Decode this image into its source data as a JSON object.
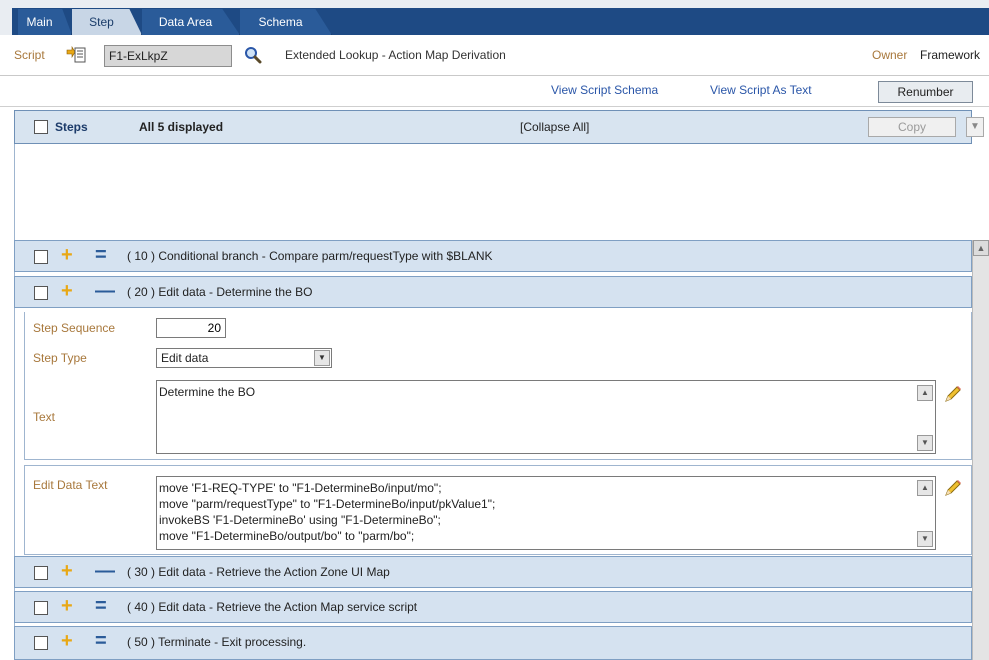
{
  "tabs": [
    {
      "label": "Main",
      "active": false
    },
    {
      "label": "Step",
      "active": true
    },
    {
      "label": "Data Area",
      "active": false
    },
    {
      "label": "Schema",
      "active": false
    }
  ],
  "script": {
    "label": "Script",
    "value": "F1-ExLkpZ",
    "description": "Extended Lookup - Action Map Derivation",
    "owner_label": "Owner",
    "owner_value": "Framework"
  },
  "links": {
    "view_schema": "View Script Schema",
    "view_text": "View Script As Text",
    "renumber": "Renumber"
  },
  "steps_header": {
    "title": "Steps",
    "count": "All 5 displayed",
    "collapse": "[Collapse All]",
    "copy": "Copy"
  },
  "steps": [
    {
      "seq": "10",
      "text": "( 10 ) Conditional branch - Compare parm/requestType with $BLANK"
    },
    {
      "seq": "20",
      "text": "( 20 ) Edit data - Determine the BO"
    },
    {
      "seq": "30",
      "text": "( 30 ) Edit data - Retrieve the Action Zone UI Map"
    },
    {
      "seq": "40",
      "text": "( 40 ) Edit data - Retrieve the Action Map service script"
    },
    {
      "seq": "50",
      "text": "( 50 ) Terminate - Exit processing."
    }
  ],
  "detail": {
    "seq_label": "Step Sequence",
    "seq_value": "20",
    "type_label": "Step Type",
    "type_value": "Edit data",
    "text_label": "Text",
    "text_value": "Determine the BO",
    "edit_label": "Edit Data Text",
    "edit_lines": [
      "move 'F1-REQ-TYPE' to \"F1-DetermineBo/input/mo\";",
      "move \"parm/requestType\" to \"F1-DetermineBo/input/pkValue1\";",
      "invokeBS 'F1-DetermineBo' using \"F1-DetermineBo\";",
      "move \"F1-DetermineBo/output/bo\" to \"parm/bo\";"
    ]
  },
  "colors": {
    "tab_bar": "#1e4a84",
    "step_row_bg": "#d5e2f0",
    "label_tan": "#a8783c",
    "plus_icon": "#e8a816",
    "link_blue": "#2a56a8"
  }
}
